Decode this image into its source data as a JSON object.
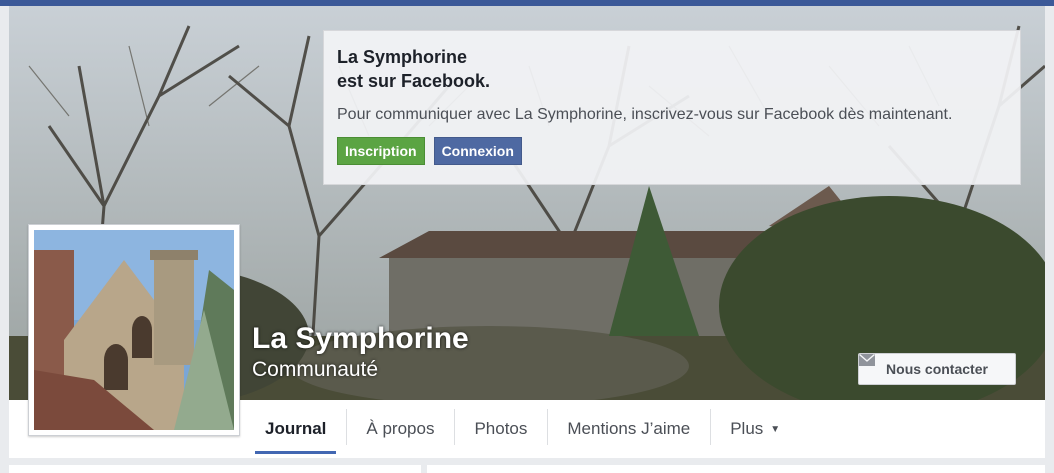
{
  "signup_box": {
    "title_line1": "La Symphorine",
    "title_line2": "est sur Facebook.",
    "message": "Pour communiquer avec La Symphorine, inscrivez-vous sur Facebook dès maintenant.",
    "signup_label": "Inscription",
    "login_label": "Connexion"
  },
  "page": {
    "name": "La Symphorine",
    "category": "Communauté",
    "contact_label": "Nous contacter"
  },
  "tabs": [
    {
      "label": "Journal",
      "active": true
    },
    {
      "label": "À propos"
    },
    {
      "label": "Photos"
    },
    {
      "label": "Mentions J’aime"
    },
    {
      "label": "Plus",
      "icon": "caret-down-icon"
    }
  ],
  "colors": {
    "brand": "#3b5998",
    "signup_green": "#5ba443",
    "login_blue": "#4e69a2",
    "active_tab_underline": "#4267b2"
  }
}
